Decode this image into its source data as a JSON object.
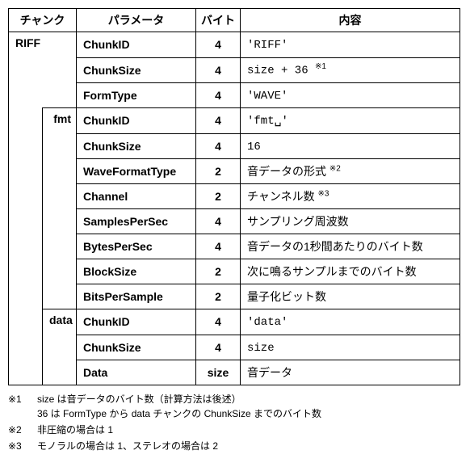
{
  "headers": {
    "chunk": "チャンク",
    "parameter": "パラメータ",
    "byte": "バイト",
    "content": "内容"
  },
  "chunks": {
    "riff": "RIFF",
    "fmt": "fmt",
    "data": "data"
  },
  "rows": [
    {
      "param": "ChunkID",
      "byte": "4",
      "desc": "'RIFF'",
      "mono": true,
      "sup": ""
    },
    {
      "param": "ChunkSize",
      "byte": "4",
      "desc": "size + 36 ",
      "mono": true,
      "sup": "※1"
    },
    {
      "param": "FormType",
      "byte": "4",
      "desc": "'WAVE'",
      "mono": true,
      "sup": ""
    },
    {
      "param": "ChunkID",
      "byte": "4",
      "desc": "'fmt␣'",
      "mono": true,
      "sup": ""
    },
    {
      "param": "ChunkSize",
      "byte": "4",
      "desc": "16",
      "mono": true,
      "sup": ""
    },
    {
      "param": "WaveFormatType",
      "byte": "2",
      "desc": "音データの形式 ",
      "mono": false,
      "sup": "※2"
    },
    {
      "param": "Channel",
      "byte": "2",
      "desc": "チャンネル数 ",
      "mono": false,
      "sup": "※3"
    },
    {
      "param": "SamplesPerSec",
      "byte": "4",
      "desc": "サンプリング周波数",
      "mono": false,
      "sup": ""
    },
    {
      "param": "BytesPerSec",
      "byte": "4",
      "desc": "音データの1秒間あたりのバイト数",
      "mono": false,
      "sup": ""
    },
    {
      "param": "BlockSize",
      "byte": "2",
      "desc": "次に鳴るサンプルまでのバイト数",
      "mono": false,
      "sup": ""
    },
    {
      "param": "BitsPerSample",
      "byte": "2",
      "desc": "量子化ビット数",
      "mono": false,
      "sup": ""
    },
    {
      "param": "ChunkID",
      "byte": "4",
      "desc": "'data'",
      "mono": true,
      "sup": ""
    },
    {
      "param": "ChunkSize",
      "byte": "4",
      "desc": "size",
      "mono": true,
      "sup": ""
    },
    {
      "param": "Data",
      "byte": "size",
      "desc": "音データ",
      "mono": false,
      "sup": ""
    }
  ],
  "footnotes": {
    "f1_mark": "※1",
    "f1_line1": "size は音データのバイト数（計算方法は後述）",
    "f1_line2": "36 は FormType から data チャンクの ChunkSize までのバイト数",
    "f2_mark": "※2",
    "f2_text": "非圧縮の場合は 1",
    "f3_mark": "※3",
    "f3_text": "モノラルの場合は 1、ステレオの場合は 2"
  }
}
